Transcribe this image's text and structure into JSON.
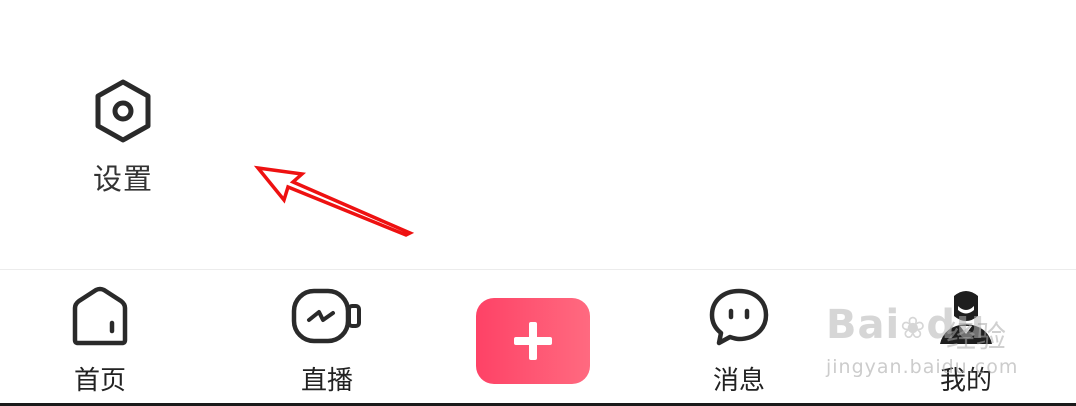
{
  "top_row": {
    "items": [
      "",
      "",
      "",
      ""
    ]
  },
  "settings": {
    "label": "设置",
    "icon": "hexagon-gear-icon"
  },
  "annotation": {
    "icon": "red-arrow-annotation",
    "color": "#ee1111"
  },
  "bottom_nav": {
    "items": [
      {
        "label": "首页",
        "icon": "home-icon"
      },
      {
        "label": "直播",
        "icon": "live-camera-icon"
      },
      {
        "label": "",
        "icon": "plus-icon"
      },
      {
        "label": "消息",
        "icon": "message-bubble-icon"
      },
      {
        "label": "我的",
        "icon": "profile-avatar-icon"
      }
    ],
    "add_button_colors": [
      "#fe4266",
      "#ff6a80"
    ]
  },
  "watermark": {
    "brand": "Bai",
    "brand_suffix": "du",
    "cn": "经验",
    "domain": "jingyan.baidu.com"
  }
}
